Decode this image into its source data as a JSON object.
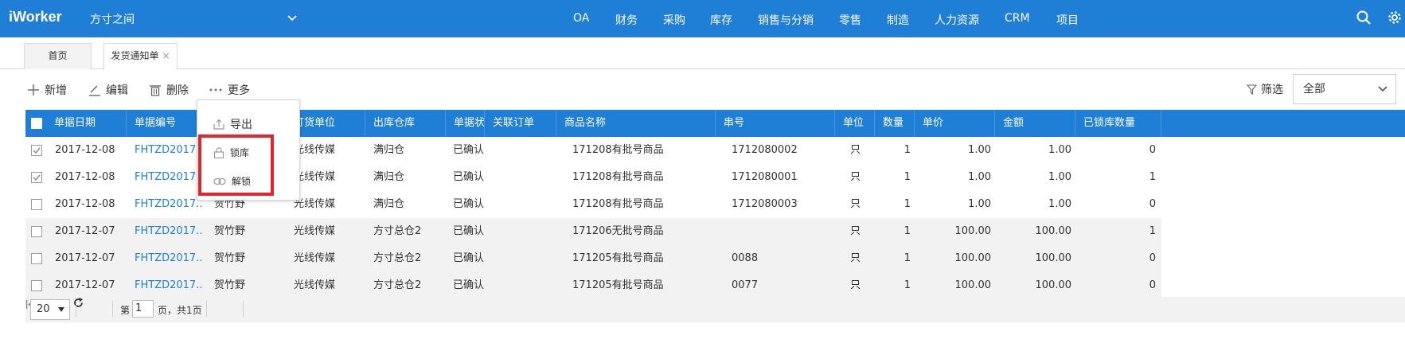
{
  "app": {
    "logo": "iWorker",
    "company": "方寸之间"
  },
  "nav": [
    "OA",
    "财务",
    "采购",
    "库存",
    "销售与分销",
    "零售",
    "制造",
    "人力资源",
    "CRM",
    "项目"
  ],
  "tabs": [
    {
      "label": "首页"
    },
    {
      "label": "发货通知单",
      "close": "×"
    }
  ],
  "toolbar": {
    "add": "新增",
    "edit": "编辑",
    "delete": "删除",
    "more": "更多",
    "filter": "筛选",
    "filter_value": "全部"
  },
  "menu": {
    "export": "导出",
    "lock": "锁库",
    "unlock": "解锁"
  },
  "columns": [
    "单据日期",
    "单据编号",
    "",
    "订货单位",
    "出库仓库",
    "单据状态",
    "关联订单",
    "商品名称",
    "串号",
    "单位",
    "数量",
    "单价",
    "金额",
    "已锁库数量"
  ],
  "rows": [
    {
      "date": "2017-12-08",
      "code": "FHTZD2017...",
      "person": "",
      "unit": "光线传媒",
      "warehouse": "满归仓",
      "status": "已确认",
      "order": "",
      "product": "171208有批号商品",
      "serial": "1712080002",
      "uom": "只",
      "qty": "1",
      "price": "1.00",
      "amount": "1.00",
      "locked": "0",
      "checked": true
    },
    {
      "date": "2017-12-08",
      "code": "FHTZD2017...",
      "person": "",
      "unit": "光线传媒",
      "warehouse": "满归仓",
      "status": "已确认",
      "order": "",
      "product": "171208有批号商品",
      "serial": "1712080001",
      "uom": "只",
      "qty": "1",
      "price": "1.00",
      "amount": "1.00",
      "locked": "1",
      "checked": true
    },
    {
      "date": "2017-12-08",
      "code": "FHTZD2017...",
      "person": "贺竹野",
      "unit": "光线传媒",
      "warehouse": "满归仓",
      "status": "已确认",
      "order": "",
      "product": "171208有批号商品",
      "serial": "1712080003",
      "uom": "只",
      "qty": "1",
      "price": "1.00",
      "amount": "1.00",
      "locked": "0",
      "checked": false
    },
    {
      "date": "2017-12-07",
      "code": "FHTZD2017...",
      "person": "贺竹野",
      "unit": "光线传媒",
      "warehouse": "方寸总仓2",
      "status": "已确认",
      "order": "",
      "product": "171206无批号商品",
      "serial": "",
      "uom": "只",
      "qty": "1",
      "price": "100.00",
      "amount": "100.00",
      "locked": "1",
      "checked": false
    },
    {
      "date": "2017-12-07",
      "code": "FHTZD2017...",
      "person": "贺竹野",
      "unit": "光线传媒",
      "warehouse": "方寸总仓2",
      "status": "已确认",
      "order": "",
      "product": "171205有批号商品",
      "serial": "0088",
      "uom": "只",
      "qty": "1",
      "price": "100.00",
      "amount": "100.00",
      "locked": "0",
      "checked": false
    },
    {
      "date": "2017-12-07",
      "code": "FHTZD2017...",
      "person": "贺竹野",
      "unit": "光线传媒",
      "warehouse": "方寸总仓2",
      "status": "已确认",
      "order": "",
      "product": "171205有批号商品",
      "serial": "0077",
      "uom": "只",
      "qty": "1",
      "price": "100.00",
      "amount": "100.00",
      "locked": "0",
      "checked": false
    }
  ],
  "pager": {
    "page_size": "20",
    "page_prefix": "第",
    "page_value": "1",
    "page_suffix": "页，共1页"
  },
  "colors": {
    "primary": "#1f7fd6",
    "highlight": "#e8242b",
    "link": "#1f7fd6"
  }
}
